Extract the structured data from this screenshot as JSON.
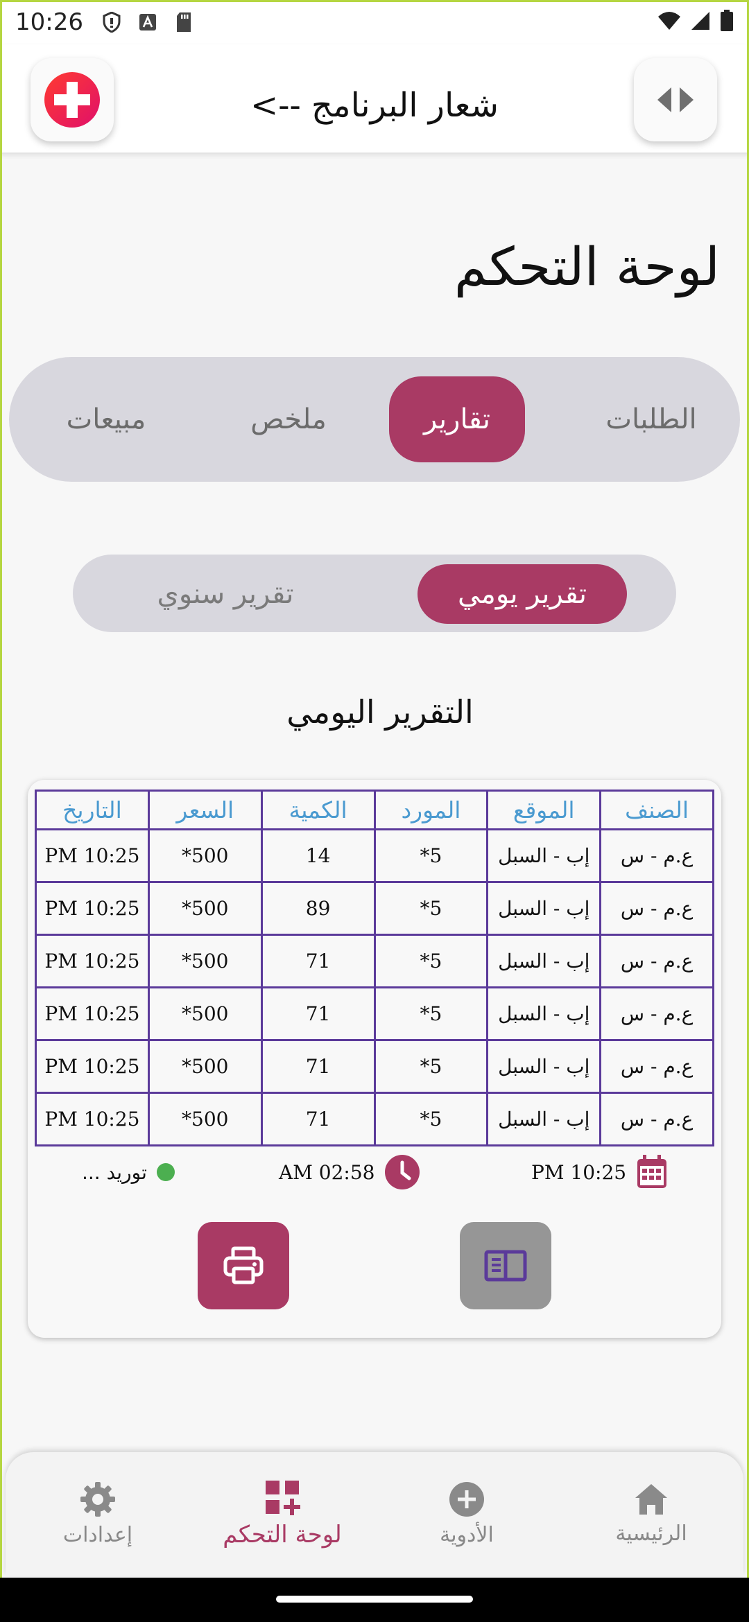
{
  "status_bar": {
    "time": "10:26"
  },
  "header": {
    "logo_text": "شعار البرنامج -->"
  },
  "page_title": "لوحة التحكم",
  "main_tabs": [
    {
      "label": "الطلبات"
    },
    {
      "label": "تقارير"
    },
    {
      "label": "ملخص"
    },
    {
      "label": "مبيعات"
    }
  ],
  "sub_tabs": [
    {
      "label": "تقرير يومي"
    },
    {
      "label": "تقرير سنوي"
    }
  ],
  "section_title": "التقرير اليومي",
  "table": {
    "headers": [
      "الصنف",
      "الموقع",
      "المورد",
      "الكمية",
      "السعر",
      "التاريخ"
    ],
    "rows": [
      [
        "ع.م - س",
        "إب - السبل",
        "5*",
        "14",
        "500*",
        "PM 10:25"
      ],
      [
        "ع.م - س",
        "إب - السبل",
        "5*",
        "89",
        "500*",
        "PM 10:25"
      ],
      [
        "ع.م - س",
        "إب - السبل",
        "5*",
        "71",
        "500*",
        "PM 10:25"
      ],
      [
        "ع.م - س",
        "إب - السبل",
        "5*",
        "71",
        "500*",
        "PM 10:25"
      ],
      [
        "ع.م - س",
        "إب - السبل",
        "5*",
        "71",
        "500*",
        "PM 10:25"
      ],
      [
        "ع.م - س",
        "إب - السبل",
        "5*",
        "71",
        "500*",
        "PM 10:25"
      ]
    ]
  },
  "report_footer": {
    "date_text": "PM 10:25",
    "time_text": "AM 02:58",
    "status_text": "توريد ..."
  },
  "bottom_nav": [
    {
      "label": "الرئيسية",
      "icon": "home-icon"
    },
    {
      "label": "الأدوية",
      "icon": "plus-circle-icon"
    },
    {
      "label": "لوحة التحكم",
      "icon": "dashboard-icon"
    },
    {
      "label": "إعدادات",
      "icon": "gear-icon"
    }
  ],
  "colors": {
    "accent": "#a93a64",
    "table_border": "#5b3a9a",
    "table_header_text": "#4a9ad0",
    "status_dot": "#4caf50",
    "tab_track": "#d8d7de"
  }
}
